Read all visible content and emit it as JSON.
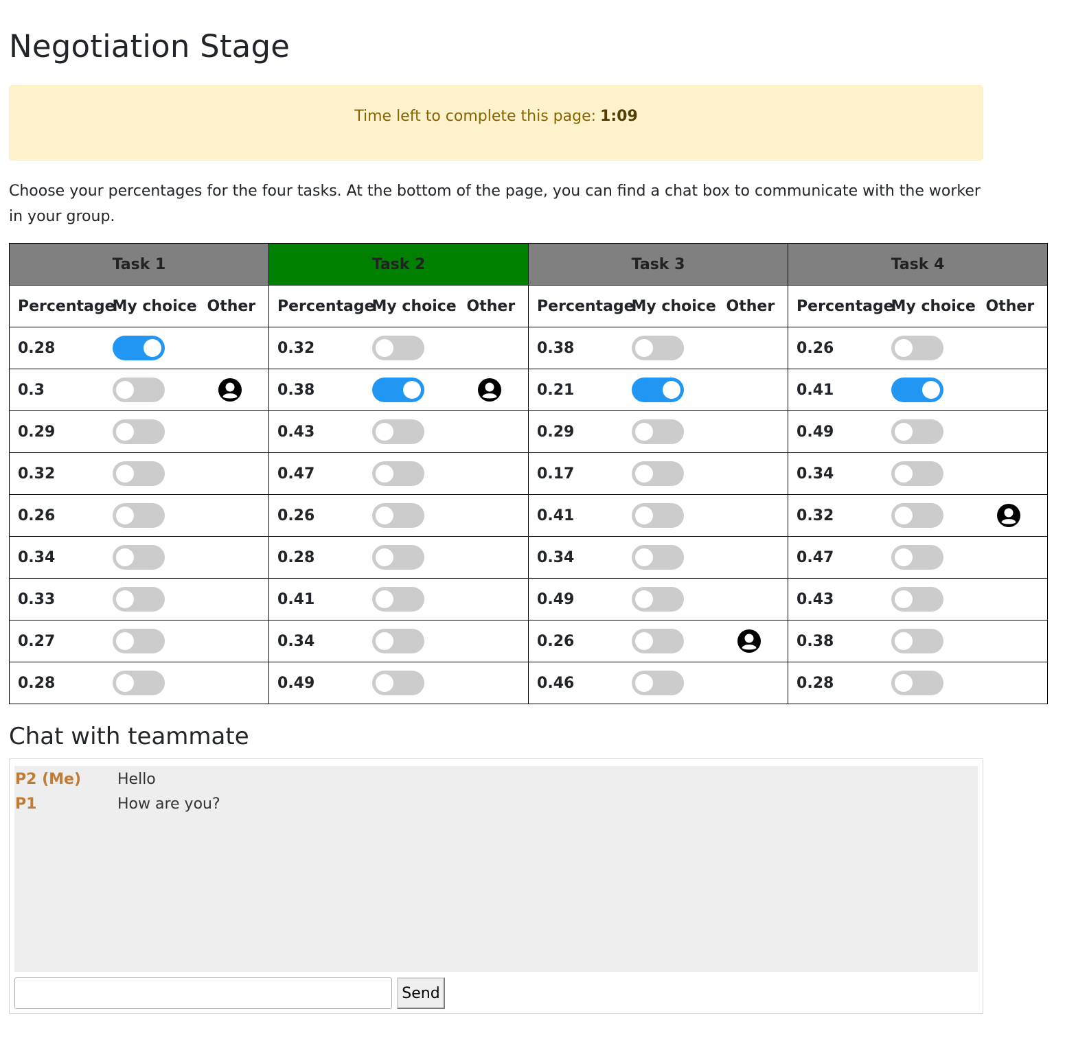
{
  "page": {
    "title": "Negotiation Stage",
    "timer_label": "Time left to complete this page:",
    "timer_value": "1:09",
    "instructions": "Choose your percentages for the four tasks. At the bottom of the page, you can find a chat box to communicate with the worker in your group."
  },
  "table": {
    "col_labels": {
      "percentage": "Percentage",
      "my_choice": "My choice",
      "other": "Other"
    },
    "tasks": [
      {
        "name": "Task 1",
        "active": false,
        "percentages": [
          "0.28",
          "0.3",
          "0.29",
          "0.32",
          "0.26",
          "0.34",
          "0.33",
          "0.27",
          "0.28"
        ],
        "my_choice_index": 0,
        "other_index": 1
      },
      {
        "name": "Task 2",
        "active": true,
        "percentages": [
          "0.32",
          "0.38",
          "0.43",
          "0.47",
          "0.26",
          "0.28",
          "0.41",
          "0.34",
          "0.49"
        ],
        "my_choice_index": 1,
        "other_index": 1
      },
      {
        "name": "Task 3",
        "active": false,
        "percentages": [
          "0.38",
          "0.21",
          "0.29",
          "0.17",
          "0.41",
          "0.34",
          "0.49",
          "0.26",
          "0.46"
        ],
        "my_choice_index": 1,
        "other_index": 7
      },
      {
        "name": "Task 4",
        "active": false,
        "percentages": [
          "0.26",
          "0.41",
          "0.49",
          "0.34",
          "0.32",
          "0.47",
          "0.43",
          "0.38",
          "0.28"
        ],
        "my_choice_index": 1,
        "other_index": 4
      }
    ],
    "colors": {
      "active_header": "#008000",
      "inactive_header": "#808080",
      "toggle_on": "#2196f3",
      "toggle_off": "#cccccc"
    },
    "icons": {
      "other_marker": "user-circle-icon"
    }
  },
  "chat": {
    "title": "Chat with teammate",
    "messages": [
      {
        "sender": "P2 (Me)",
        "text": "Hello"
      },
      {
        "sender": "P1",
        "text": "How are you?"
      }
    ],
    "input_placeholder": "",
    "send_label": "Send",
    "sender_color": "#c07b34"
  }
}
